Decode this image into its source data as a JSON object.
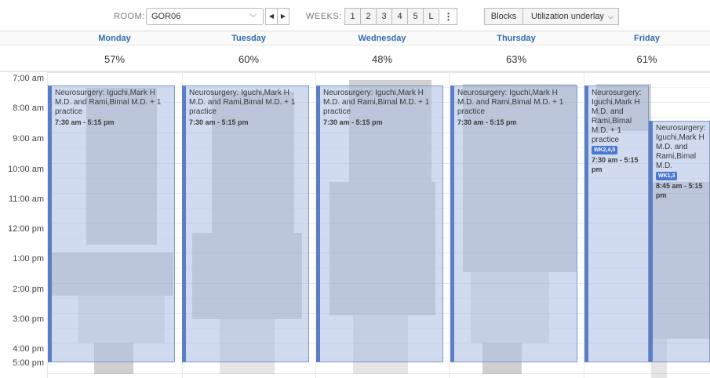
{
  "toolbar": {
    "room_label": "ROOM:",
    "room_value": "GOR06",
    "weeks_label": "WEEKS:",
    "weeks": [
      "1",
      "2",
      "3",
      "4",
      "5",
      "L"
    ],
    "blocks_label": "Blocks",
    "utilization_label": "Utilization underlay"
  },
  "days": [
    {
      "name": "Monday",
      "utilization": "57%"
    },
    {
      "name": "Tuesday",
      "utilization": "60%"
    },
    {
      "name": "Wednesday",
      "utilization": "48%"
    },
    {
      "name": "Thursday",
      "utilization": "63%"
    },
    {
      "name": "Friday",
      "utilization": "61%"
    }
  ],
  "times": [
    "7:00 am",
    "8:00 am",
    "9:00 am",
    "10:00 am",
    "11:00 am",
    "12:00 pm",
    "1:00 pm",
    "2:00 pm",
    "3:00 pm",
    "4:00 pm",
    "5:00 pm"
  ],
  "blocks": {
    "mon": {
      "name": "Neurosurgery: Iguchi,Mark H M.D. and Rami,Bimal M.D. + 1 practice",
      "time": "7:30 am - 5:15 pm"
    },
    "tue": {
      "name": "Neurosurgery: Iguchi,Mark H M.D. and Rami,Bimal M.D. + 1 practice",
      "time": "7:30 am - 5:15 pm"
    },
    "wed": {
      "name": "Neurosurgery: Iguchi,Mark H M.D. and Rami,Bimal M.D. + 1 practice",
      "time": "7:30 am - 5:15 pm"
    },
    "thu": {
      "name": "Neurosurgery: Iguchi,Mark H M.D. and Rami,Bimal M.D. + 1 practice",
      "time": "7:30 am - 5:15 pm"
    },
    "fri1": {
      "name": "Neurosurgery: Iguchi,Mark H M.D. and Rami,Bimal M.D. + 1 practice",
      "badge": "WK2,4,5",
      "time": "7:30 am - 5:15 pm"
    },
    "fri2": {
      "name": "Neurosurgery: Iguchi,Mark H M.D. and Rami,Bimal M.D.",
      "badge": "WK1,3",
      "time": "8:45 am - 5:15 pm"
    }
  },
  "colors": {
    "accent": "#2f6fb0",
    "block_border": "#5a7ec6",
    "block_fill": "#aabee1",
    "badge": "#4a78d0"
  }
}
